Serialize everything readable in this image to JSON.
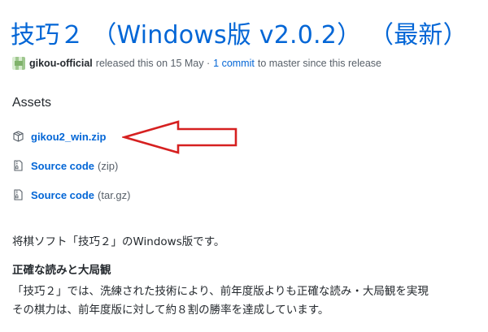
{
  "release": {
    "title": "技巧２ （Windows版 v2.0.2） （最新）",
    "author": "gikou-official",
    "released_text": "released this on 15 May ·",
    "commit_link": "1 commit",
    "commit_suffix": "to master since this release"
  },
  "assets": {
    "heading": "Assets",
    "items": [
      {
        "name": "gikou2_win.zip",
        "suffix": "",
        "icon": "package-icon"
      },
      {
        "name": "Source code",
        "suffix": "(zip)",
        "icon": "file-zip-icon"
      },
      {
        "name": "Source code",
        "suffix": "(tar.gz)",
        "icon": "file-zip-icon"
      }
    ]
  },
  "annotation": {
    "arrow_color": "#d62020"
  },
  "description": {
    "intro": "将棋ソフト「技巧２」のWindows版です。",
    "section_title": "正確な読みと大局観",
    "line1": "「技巧２」では、洗練された技術により、前年度版よりも正確な読み・大局観を実現",
    "line2": "その棋力は、前年度版に対して約８割の勝率を達成しています。"
  },
  "colors": {
    "link": "#0366d6",
    "muted": "#586069",
    "text": "#24292e"
  }
}
